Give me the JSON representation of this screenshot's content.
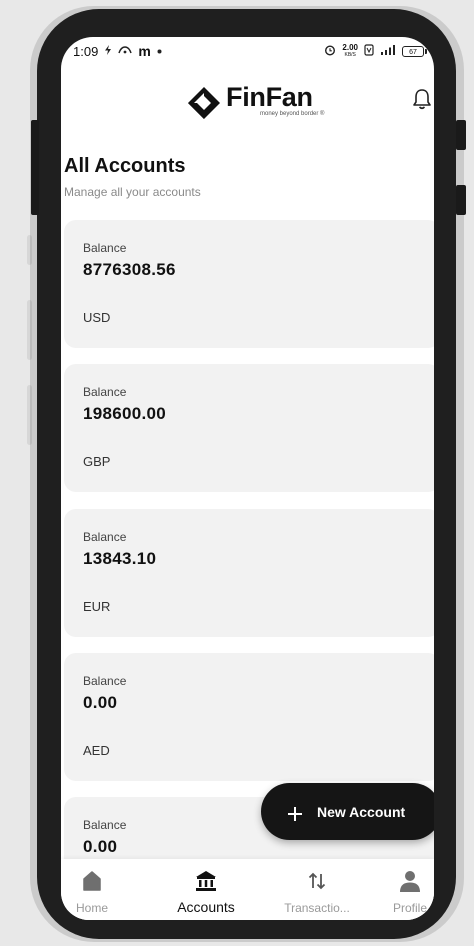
{
  "status_bar": {
    "time": "1:09",
    "left_icons": [
      "flash-icon",
      "wifi-calling-icon",
      "m-app-icon",
      "dot-icon"
    ],
    "m_glyph": "m",
    "speed_value": "2.00",
    "speed_unit": "KB/S",
    "battery": "67"
  },
  "header": {
    "brand_name": "FinFan",
    "brand_tagline": "money beyond border ®"
  },
  "page": {
    "title": "All Accounts",
    "subtitle": "Manage all your accounts"
  },
  "accounts": [
    {
      "label": "Balance",
      "balance": "8776308.56",
      "currency": "USD"
    },
    {
      "label": "Balance",
      "balance": "198600.00",
      "currency": "GBP"
    },
    {
      "label": "Balance",
      "balance": "13843.10",
      "currency": "EUR"
    },
    {
      "label": "Balance",
      "balance": "0.00",
      "currency": "AED"
    },
    {
      "label": "Balance",
      "balance": "0.00",
      "currency": ""
    }
  ],
  "fab": {
    "icon": "plus-icon",
    "label": "New Account"
  },
  "bottom_nav": {
    "active": "accounts",
    "items": [
      {
        "id": "home",
        "label": "Home",
        "icon": "home-icon"
      },
      {
        "id": "accounts",
        "label": "Accounts",
        "icon": "bank-icon"
      },
      {
        "id": "transactions",
        "label": "Transactio...",
        "icon": "transfer-arrows-icon"
      },
      {
        "id": "profile",
        "label": "Profile",
        "icon": "person-icon"
      }
    ]
  },
  "colors": {
    "card_bg": "#f2f2f2",
    "fab_bg": "#151515",
    "nav_inactive": "#9a9a9a",
    "text_primary": "#111111",
    "text_muted": "#8a8a8a"
  }
}
